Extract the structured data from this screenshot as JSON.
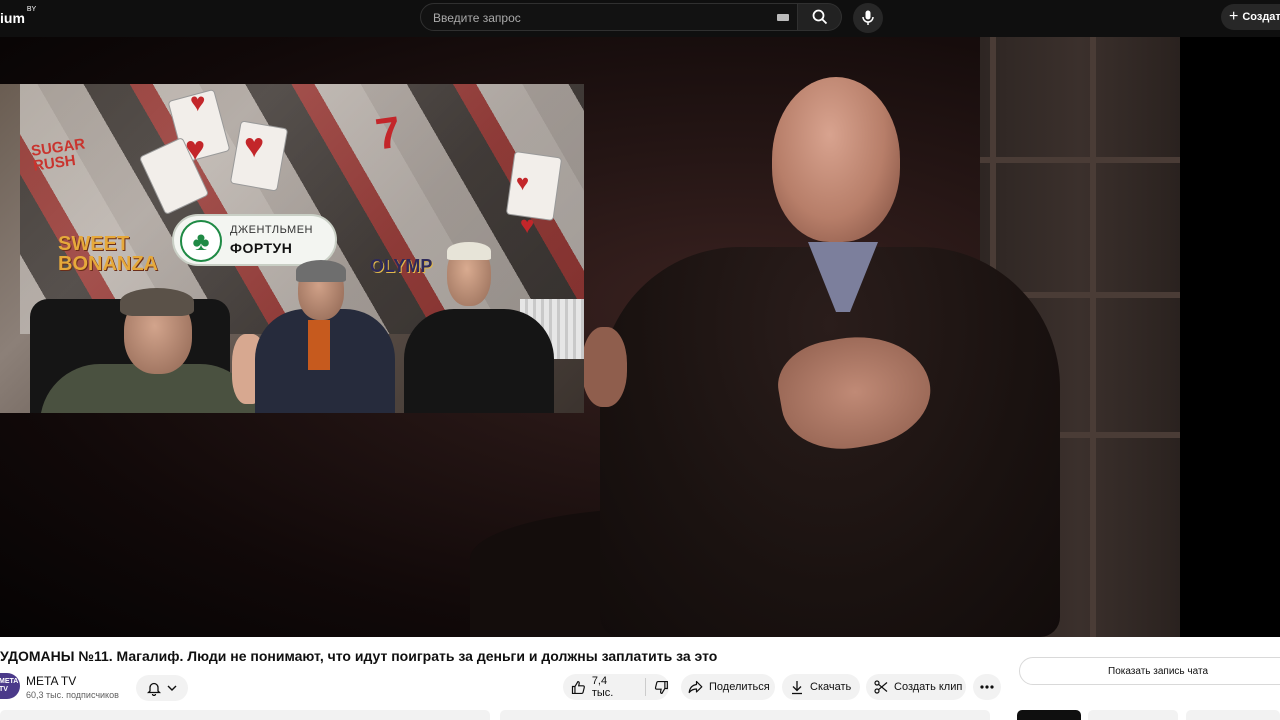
{
  "header": {
    "logo_text": "ium",
    "logo_region": "BY",
    "search_placeholder": "Введите запрос",
    "create_label": "Создать"
  },
  "video": {
    "inset": {
      "badge_line1": "ДЖЕНТЛЬМЕН",
      "badge_line2": "ФОРТУН",
      "wall_texts": [
        "SUGAR RUSH",
        "SWEET BONANZA",
        "OLYMP",
        "7"
      ]
    }
  },
  "info": {
    "title": "УДОМАНЫ №11. Магалиф. Люди не понимают, что идут поиграть за деньги и должны заплатить за это",
    "channel": {
      "avatar_text": "META TV",
      "name": "META TV",
      "subscribers": "60,3 тыс. подписчиков"
    },
    "actions": {
      "likes": "7,4 тыс.",
      "share": "Поделиться",
      "download": "Скачать",
      "clip": "Создать клип"
    },
    "chat_button": "Показать запись чата"
  },
  "colors": {
    "topbar_bg": "#0f0f0f",
    "pill_bg": "#f2f2f2",
    "badge_green": "#1f8a45"
  }
}
